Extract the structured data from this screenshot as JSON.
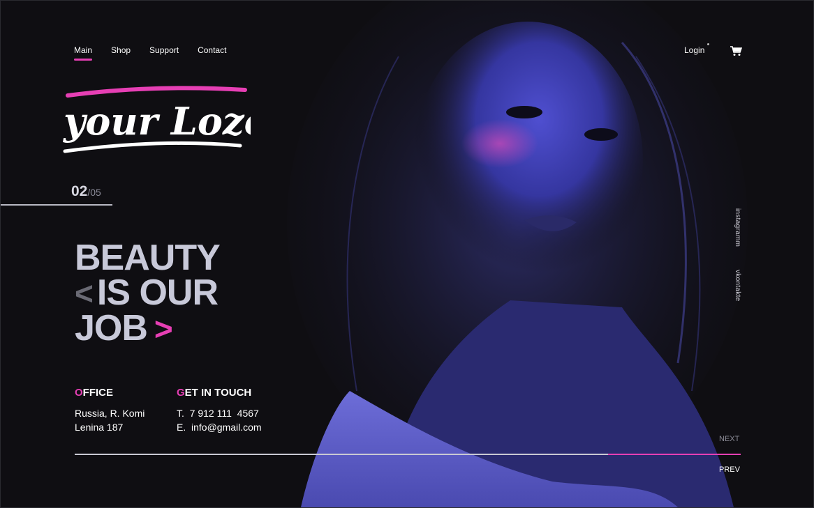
{
  "nav": {
    "items": [
      {
        "label": "Main",
        "active": true
      },
      {
        "label": "Shop",
        "active": false
      },
      {
        "label": "Support",
        "active": false
      },
      {
        "label": "Contact",
        "active": false
      }
    ],
    "login": "Login"
  },
  "logo": {
    "text": "your Lozo"
  },
  "slider": {
    "current": "02",
    "total": "/05",
    "next": "NEXT",
    "prev": "PREV"
  },
  "hero": {
    "line1": "BEAUTY",
    "line2": "IS OUR",
    "line3": "JOB",
    "chevron_left": "<",
    "chevron_right": ">"
  },
  "office": {
    "title_first": "O",
    "title_rest": "FFICE",
    "text": "Russia, R. Komi\nLenina 187"
  },
  "contact": {
    "title_first": "G",
    "title_rest": "ET IN TOUCH",
    "text": "T.  7 912 111  4567\nE.  info@gmail.com"
  },
  "social": [
    "instagramm",
    "vkontakte"
  ],
  "colors": {
    "accent": "#e63fb4",
    "background": "#0f0e12",
    "headline": "#c8c9d9",
    "photo_tint": "#3a3aa8"
  },
  "icons": {
    "cart": "cart-icon"
  }
}
